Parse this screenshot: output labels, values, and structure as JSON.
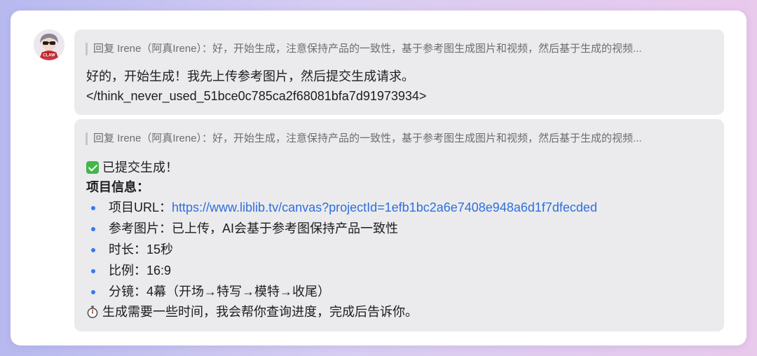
{
  "avatar": {
    "badge_text": "CLAW"
  },
  "messages": [
    {
      "quote": "回复 Irene（阿真Irene）：好，开始生成，注意保持产品的一致性，基于参考图生成图片和视频，然后基于生成的视频...",
      "lines": [
        "好的，开始生成！我先上传参考图片，然后提交生成请求。",
        "</think_never_used_51bce0c785ca2f68081bfa7d91973934>"
      ]
    },
    {
      "quote": "回复 Irene（阿真Irene）：好，开始生成，注意保持产品的一致性，基于参考图生成图片和视频，然后基于生成的视频...",
      "status": "已提交生成！",
      "section_title": "项目信息：",
      "items": [
        {
          "label": "项目URL：",
          "value": "https://www.liblib.tv/canvas?projectId=1efb1bc2a6e7408e948a6d1f7dfecded"
        },
        {
          "label": "参考图片：",
          "value": "已上传，AI会基于参考图保持产品一致性"
        },
        {
          "label": "时长：",
          "value": "15秒"
        },
        {
          "label": "比例：",
          "value": "16:9"
        },
        {
          "label": "分镜：",
          "value": "4幕（开场→特写→模特→收尾）"
        }
      ],
      "footer": "生成需要一些时间，我会帮你查询进度，完成后告诉你。"
    }
  ],
  "colors": {
    "bubble_bg": "#ebebed",
    "link": "#2f6fdc",
    "bullet": "#3478f6",
    "check": "#43b649"
  },
  "icons": {
    "status": "check-mark-icon",
    "footer": "stopwatch-icon"
  }
}
